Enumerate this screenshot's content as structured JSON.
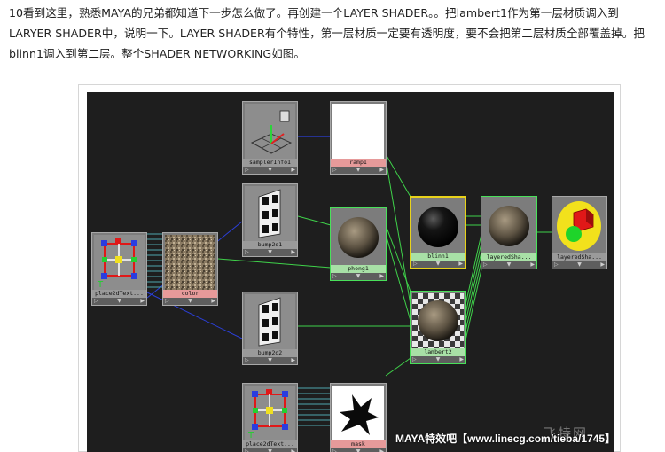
{
  "article": {
    "paragraph": "10看到这里，熟悉MAYA的兄弟都知道下一步怎么做了。再创建一个LAYER SHADER。。把lambert1作为第一层材质调入到LARYER SHADER中，说明一下。LAYER SHADER有个特性，第一层材质一定要有透明度，要不会把第二层材质全部覆盖掉。把blinn1调入到第二层。整个SHADER NETWORKING如图。"
  },
  "hypershade": {
    "nodes": [
      {
        "id": "samplerInfo1",
        "label": "samplerInfo1",
        "icon": "sampler-info-icon",
        "label_color": "gray",
        "state": "normal"
      },
      {
        "id": "ramp1",
        "label": "ramp1",
        "icon": "ramp-texture-icon",
        "label_color": "pink",
        "state": "normal"
      },
      {
        "id": "bump2d1",
        "label": "bump2d1",
        "icon": "bump-checker-icon",
        "label_color": "gray",
        "state": "normal"
      },
      {
        "id": "phong1",
        "label": "phong1",
        "icon": "stone-sphere-icon",
        "label_color": "green",
        "state": "selected-green"
      },
      {
        "id": "blinn1",
        "label": "blinn1",
        "icon": "black-sphere-icon",
        "label_color": "green",
        "state": "selected-yellow"
      },
      {
        "id": "layeredSha1",
        "label": "layeredSha...",
        "icon": "stone-sphere-icon",
        "label_color": "green",
        "state": "selected-green"
      },
      {
        "id": "layeredSha2",
        "label": "layeredSha...",
        "icon": "shading-group-icon",
        "label_color": "gray",
        "state": "normal"
      },
      {
        "id": "place2dText1",
        "label": "place2dText...",
        "icon": "place2d-texture-icon",
        "label_color": "gray",
        "state": "normal"
      },
      {
        "id": "color",
        "label": "color",
        "icon": "stone-texture-icon",
        "label_color": "pink",
        "state": "normal"
      },
      {
        "id": "bump2d2",
        "label": "bump2d2",
        "icon": "bump-checker-icon",
        "label_color": "gray",
        "state": "normal"
      },
      {
        "id": "lambert2",
        "label": "lambert2",
        "icon": "checker-sphere-icon",
        "label_color": "green",
        "state": "selected-green"
      },
      {
        "id": "place2dText2",
        "label": "place2dText...",
        "icon": "place2d-texture-icon",
        "label_color": "gray",
        "state": "normal"
      },
      {
        "id": "mask",
        "label": "mask",
        "icon": "mask-texture-icon",
        "label_color": "pink",
        "state": "normal"
      }
    ],
    "colors": {
      "canvas": "#1e1e1e",
      "wire_green": "#3fd24a",
      "wire_blue": "#2b3fd8",
      "wire_cyan": "#5fd6e0",
      "select_yellow": "#e8d21a"
    }
  },
  "watermark": {
    "text": "MAYA特效吧【www.linecg.com/tieba/1745】",
    "logo_text": "飞特网"
  }
}
